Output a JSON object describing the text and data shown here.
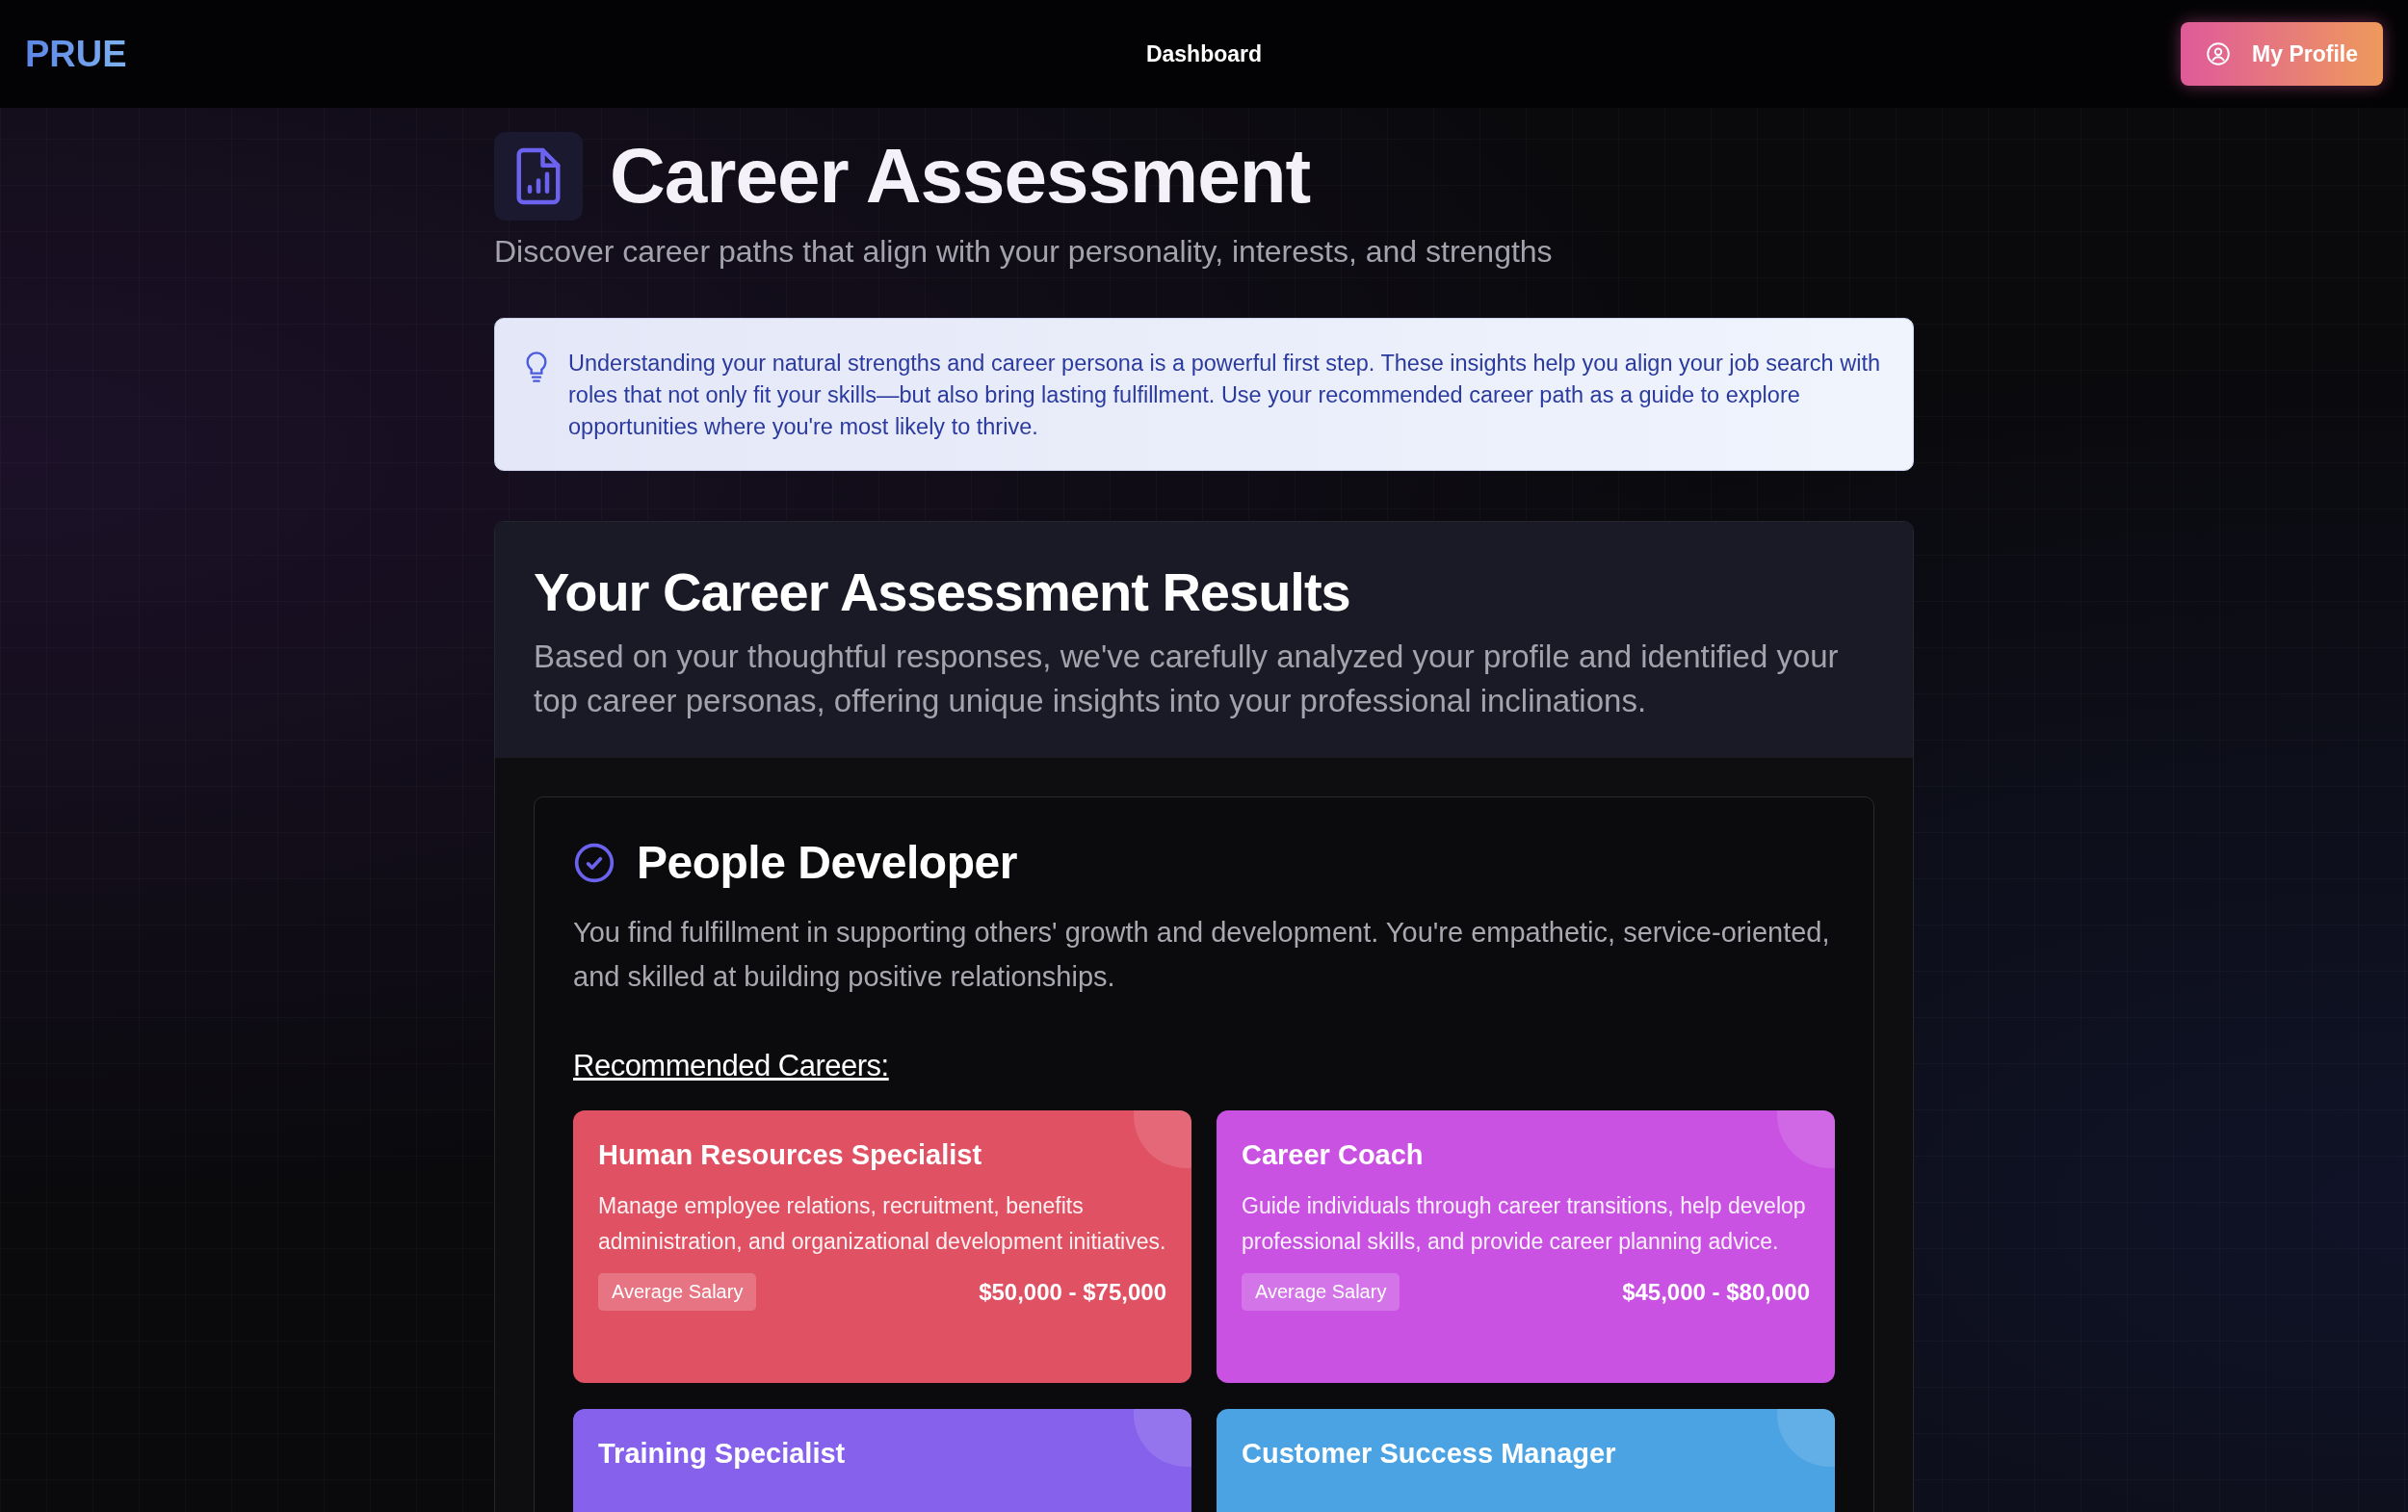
{
  "header": {
    "logo": "PRUE",
    "nav": "Dashboard",
    "profile_button": "My Profile"
  },
  "page": {
    "title": "Career Assessment",
    "subtitle": "Discover career paths that align with your personality, interests, and strengths"
  },
  "info_note": "Understanding your natural strengths and career persona is a powerful first step. These insights help you align your job search with roles that not only fit your skills—but also bring lasting fulfillment. Use your recommended career path as a guide to explore opportunities where you're most likely to thrive.",
  "results": {
    "title": "Your Career Assessment Results",
    "description": "Based on your thoughtful responses, we've carefully analyzed your profile and identified your top career personas, offering unique insights into your professional inclinations.",
    "persona": {
      "title": "People Developer",
      "description": "You find fulfillment in supporting others' growth and development. You're empathetic, service-oriented, and skilled at building positive relationships.",
      "careers_heading": "Recommended Careers:",
      "careers": [
        {
          "title": "Human Resources Specialist",
          "color": "#e05263",
          "description": "Manage employee relations, recruitment, benefits administration, and organizational development initiatives.",
          "salary_label": "Average Salary",
          "salary": "$50,000 - $75,000"
        },
        {
          "title": "Career Coach",
          "color": "#c952e3",
          "description": "Guide individuals through career transitions, help develop professional skills, and provide career planning advice.",
          "salary_label": "Average Salary",
          "salary": "$45,000 - $80,000"
        },
        {
          "title": "Training Specialist",
          "color": "#8661ec"
        },
        {
          "title": "Customer Success Manager",
          "color": "#4ba3e3"
        }
      ]
    }
  }
}
